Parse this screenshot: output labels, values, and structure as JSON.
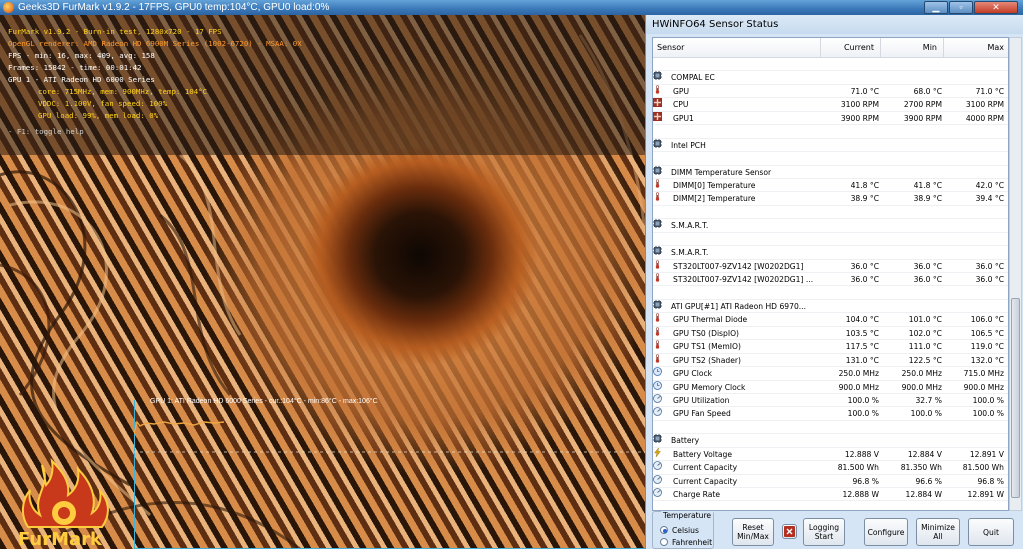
{
  "furmark": {
    "window_title": "Geeks3D FurMark v1.9.2 - 17FPS, GPU0 temp:104°C, GPU0 load:0%",
    "overlay": {
      "line1": "FurMark v1.9.2 - Burn-in test, 1280x720 - 17 FPS",
      "line2": "OpenGL renderer: AMD Radeon HD 6900M Series   (1002-6720) - MSAA: 0X",
      "line3": "FPS - min: 16, max: 409, avg: 158",
      "line4": "Frames: 15842 - time: 00:01:42",
      "line5": "GPU 1 - ATI Radeon HD 6000 Series",
      "line6": "core: 715MHz, mem: 900MHz, temp: 104°C",
      "line7": "VDDC: 1.100V, fan speed: 100%",
      "line8": "GPU load: 99%, mem load: 0%",
      "line9": "- F1: toggle help"
    },
    "graph_label": "GPU 1: ATI Radeon HD 6000 Series - cur.:104°C - min:86°C - max:106°C",
    "logo_text": "FurMark",
    "colors": {
      "yellow": "#ffd21a",
      "orange": "#ff9a2e",
      "white": "#ffffff",
      "graph_axis": "#3fb0d8",
      "temp_line": "#f0a640"
    }
  },
  "hwinfo": {
    "window_title": "HWiNFO64 Sensor Status",
    "columns": {
      "sensor": "Sensor",
      "current": "Current",
      "min": "Min",
      "max": "Max"
    },
    "rows": [
      {
        "type": "blank"
      },
      {
        "type": "group",
        "name": "COMPAL EC",
        "icon": "chip-icon"
      },
      {
        "type": "item",
        "icon": "thermometer-icon",
        "name": "GPU",
        "current": "71.0 °C",
        "min": "68.0 °C",
        "max": "71.0 °C"
      },
      {
        "type": "item",
        "icon": "fan-icon",
        "name": "CPU",
        "current": "3100 RPM",
        "min": "2700 RPM",
        "max": "3100 RPM"
      },
      {
        "type": "item",
        "icon": "fan-icon",
        "name": "GPU1",
        "current": "3900 RPM",
        "min": "3900 RPM",
        "max": "4000 RPM"
      },
      {
        "type": "blank"
      },
      {
        "type": "group",
        "name": "Intel PCH",
        "icon": "chip-icon"
      },
      {
        "type": "blank"
      },
      {
        "type": "group",
        "name": "DIMM Temperature Sensor",
        "icon": "chip-icon"
      },
      {
        "type": "item",
        "icon": "thermometer-icon",
        "name": "DIMM[0] Temperature",
        "current": "41.8 °C",
        "min": "41.8 °C",
        "max": "42.0 °C"
      },
      {
        "type": "item",
        "icon": "thermometer-icon",
        "name": "DIMM[2] Temperature",
        "current": "38.9 °C",
        "min": "38.9 °C",
        "max": "39.4 °C"
      },
      {
        "type": "blank"
      },
      {
        "type": "group",
        "name": "S.M.A.R.T.",
        "icon": "chip-icon"
      },
      {
        "type": "blank"
      },
      {
        "type": "group",
        "name": "S.M.A.R.T.",
        "icon": "chip-icon"
      },
      {
        "type": "item",
        "icon": "thermometer-icon",
        "name": "ST320LT007-9ZV142 [W0202DG1]",
        "current": "36.0 °C",
        "min": "36.0 °C",
        "max": "36.0 °C"
      },
      {
        "type": "item",
        "icon": "thermometer-icon",
        "name": "ST320LT007-9ZV142 [W0202DG1] ...",
        "current": "36.0 °C",
        "min": "36.0 °C",
        "max": "36.0 °C"
      },
      {
        "type": "blank"
      },
      {
        "type": "group",
        "name": "ATI GPU[#1] ATI Radeon HD 6970...",
        "icon": "chip-icon"
      },
      {
        "type": "item",
        "icon": "thermometer-icon",
        "name": "GPU Thermal Diode",
        "current": "104.0 °C",
        "min": "101.0 °C",
        "max": "106.0 °C"
      },
      {
        "type": "item",
        "icon": "thermometer-icon",
        "name": "GPU TS0 (DispIO)",
        "current": "103.5 °C",
        "min": "102.0 °C",
        "max": "106.5 °C"
      },
      {
        "type": "item",
        "icon": "thermometer-icon",
        "name": "GPU TS1 (MemIO)",
        "current": "117.5 °C",
        "min": "111.0 °C",
        "max": "119.0 °C"
      },
      {
        "type": "item",
        "icon": "thermometer-icon",
        "name": "GPU TS2 (Shader)",
        "current": "131.0 °C",
        "min": "122.5 °C",
        "max": "132.0 °C"
      },
      {
        "type": "item",
        "icon": "clock-icon",
        "name": "GPU Clock",
        "current": "250.0 MHz",
        "min": "250.0 MHz",
        "max": "715.0 MHz"
      },
      {
        "type": "item",
        "icon": "clock-icon",
        "name": "GPU Memory Clock",
        "current": "900.0 MHz",
        "min": "900.0 MHz",
        "max": "900.0 MHz"
      },
      {
        "type": "item",
        "icon": "gauge-icon",
        "name": "GPU Utilization",
        "current": "100.0 %",
        "min": "32.7 %",
        "max": "100.0 %"
      },
      {
        "type": "item",
        "icon": "gauge-icon",
        "name": "GPU Fan Speed",
        "current": "100.0 %",
        "min": "100.0 %",
        "max": "100.0 %"
      },
      {
        "type": "blank"
      },
      {
        "type": "group",
        "name": "Battery",
        "icon": "chip-icon"
      },
      {
        "type": "item",
        "icon": "bolt-icon",
        "name": "Battery Voltage",
        "current": "12.888 V",
        "min": "12.884 V",
        "max": "12.891 V"
      },
      {
        "type": "item",
        "icon": "gauge-icon",
        "name": "Current Capacity",
        "current": "81.500 Wh",
        "min": "81.350 Wh",
        "max": "81.500 Wh"
      },
      {
        "type": "item",
        "icon": "gauge-icon",
        "name": "Current Capacity",
        "current": "96.8 %",
        "min": "96.6 %",
        "max": "96.8 %"
      },
      {
        "type": "item",
        "icon": "gauge-icon",
        "name": "Charge Rate",
        "current": "12.888 W",
        "min": "12.884 W",
        "max": "12.891 W"
      }
    ],
    "temperature": {
      "legend": "Temperature",
      "celsius": "Celsius",
      "fahrenheit": "Fahrenheit",
      "selected": "celsius"
    },
    "buttons": {
      "reset_line1": "Reset",
      "reset_line2": "Min/Max",
      "logging_line1": "Logging",
      "logging_line2": "Start",
      "configure": "Configure",
      "minimize_line1": "Minimize",
      "minimize_line2": "All",
      "quit": "Quit"
    },
    "colors": {
      "window_bg": "#d6e5f5",
      "list_bg": "#ffffff",
      "thermometer": "#c0392b",
      "fan": "#b23a2b",
      "clock": "#3b6fb5"
    }
  }
}
